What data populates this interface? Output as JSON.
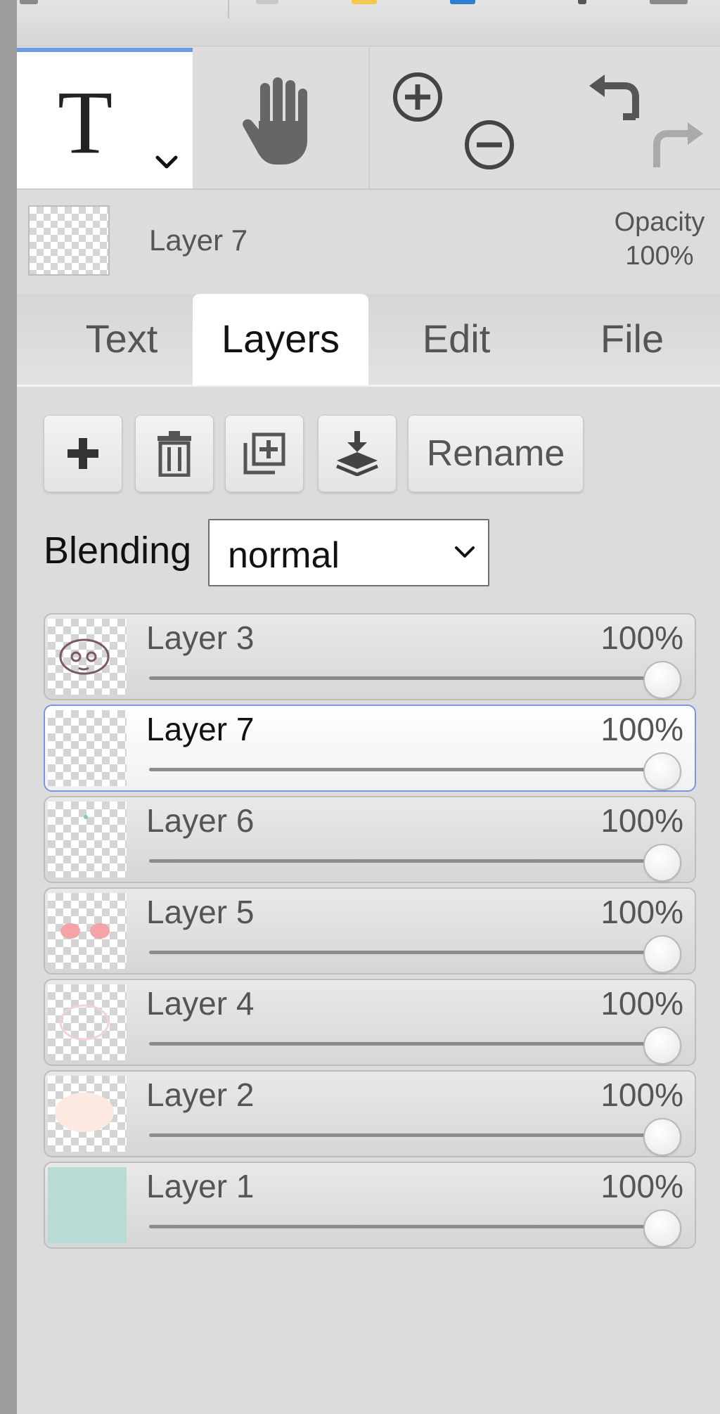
{
  "toolbar": {
    "active_tool": "T",
    "tools": [
      "text-tool",
      "hand-tool",
      "zoom-tool",
      "history-tool"
    ]
  },
  "current_layer": {
    "name": "Layer 7",
    "opacity_label": "Opacity",
    "opacity_value": "100%"
  },
  "tabs": [
    {
      "label": "Text",
      "active": false
    },
    {
      "label": "Layers",
      "active": true
    },
    {
      "label": "Edit",
      "active": false
    },
    {
      "label": "File",
      "active": false
    }
  ],
  "actions": {
    "add_icon": "plus-icon",
    "delete_icon": "trash-icon",
    "duplicate_icon": "duplicate-icon",
    "merge_icon": "merge-down-icon",
    "rename_label": "Rename"
  },
  "blending": {
    "label": "Blending",
    "value": "normal"
  },
  "layers": [
    {
      "name": "Layer 3",
      "opacity": "100%",
      "level": 1.0,
      "selected": false,
      "thumb": "face-outline"
    },
    {
      "name": "Layer 7",
      "opacity": "100%",
      "level": 1.0,
      "selected": true,
      "thumb": "empty"
    },
    {
      "name": "Layer 6",
      "opacity": "100%",
      "level": 1.0,
      "selected": false,
      "thumb": "dot"
    },
    {
      "name": "Layer 5",
      "opacity": "100%",
      "level": 1.0,
      "selected": false,
      "thumb": "cheeks"
    },
    {
      "name": "Layer 4",
      "opacity": "100%",
      "level": 1.0,
      "selected": false,
      "thumb": "faint-outline"
    },
    {
      "name": "Layer 2",
      "opacity": "100%",
      "level": 1.0,
      "selected": false,
      "thumb": "skin-oval"
    },
    {
      "name": "Layer 1",
      "opacity": "100%",
      "level": 1.0,
      "selected": false,
      "thumb": "background-fill"
    }
  ],
  "colors": {
    "accent": "#6c9be0",
    "selected_border": "#7a96e2",
    "background_fill": "#b8dcd5",
    "cheek_pink": "#f5a2a8",
    "skin": "#fbe9e2",
    "outline": "#7a5a5f"
  }
}
